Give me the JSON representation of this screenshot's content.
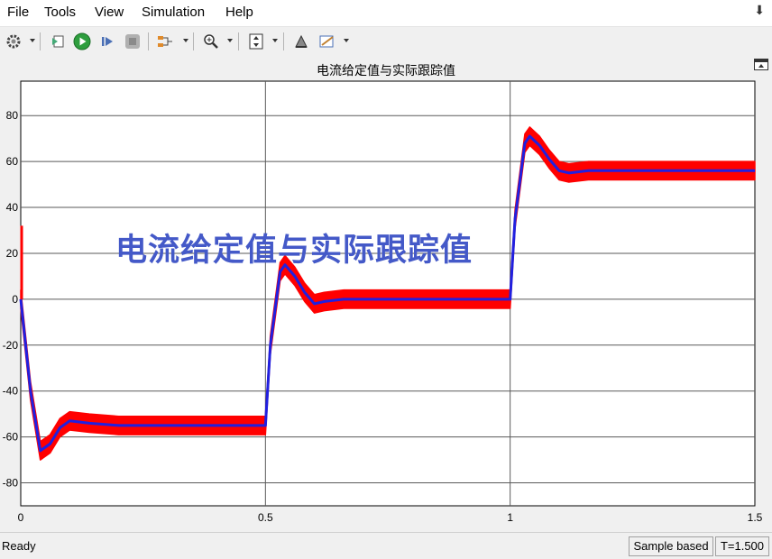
{
  "menu": {
    "items": [
      "File",
      "Tools",
      "View",
      "Simulation",
      "Help"
    ]
  },
  "toolbar": {
    "icons": [
      "gear-icon",
      "restore-config-icon",
      "run-icon",
      "step-forward-icon",
      "stop-icon",
      "signal-select-icon",
      "zoom-icon",
      "autoscale-icon",
      "highlight-icon",
      "style-icon"
    ]
  },
  "plot": {
    "title": "电流给定值与实际跟踪值",
    "overlay_text": "电流给定值与实际跟踪值"
  },
  "status": {
    "text": "Ready",
    "mode": "Sample based",
    "time": "T=1.500"
  },
  "colors": {
    "actual": "#ff0000",
    "reference": "#2020e0",
    "overlay_text": "#4459c8",
    "background": "#ffffff"
  },
  "chart_data": {
    "type": "line",
    "title": "电流给定值与实际跟踪值",
    "xlabel": "",
    "ylabel": "",
    "xlim": [
      0,
      1.5
    ],
    "ylim": [
      -90,
      95
    ],
    "xticks": [
      "0",
      "0.5",
      "1",
      "1.5"
    ],
    "yticks": [
      "-80",
      "-60",
      "-40",
      "-20",
      "0",
      "20",
      "40",
      "60",
      "80"
    ],
    "grid": true,
    "series": [
      {
        "color": "#ff0000",
        "style": "band",
        "x": [
          0,
          0.02,
          0.04,
          0.06,
          0.08,
          0.1,
          0.14,
          0.2,
          0.3,
          0.4,
          0.5,
          0.51,
          0.53,
          0.54,
          0.56,
          0.58,
          0.6,
          0.62,
          0.66,
          0.7,
          0.8,
          0.9,
          1.0,
          1.01,
          1.03,
          1.04,
          1.06,
          1.08,
          1.1,
          1.12,
          1.16,
          1.2,
          1.3,
          1.4,
          1.5
        ],
        "y": [
          0,
          -40,
          -66,
          -63,
          -56,
          -53,
          -54,
          -55,
          -55,
          -55,
          -55,
          -20,
          12,
          15,
          10,
          3,
          -2,
          -1,
          0,
          0,
          0,
          0,
          0,
          35,
          68,
          71,
          67,
          61,
          56,
          55,
          56,
          56,
          56,
          56,
          56
        ],
        "half_width": 4
      },
      {
        "color": "#2020e0",
        "style": "line",
        "x": [
          0,
          0.02,
          0.04,
          0.06,
          0.08,
          0.1,
          0.14,
          0.2,
          0.3,
          0.4,
          0.5,
          0.51,
          0.53,
          0.54,
          0.56,
          0.58,
          0.6,
          0.62,
          0.66,
          0.7,
          0.8,
          0.9,
          1.0,
          1.01,
          1.03,
          1.04,
          1.06,
          1.08,
          1.1,
          1.12,
          1.16,
          1.2,
          1.3,
          1.4,
          1.5
        ],
        "y": [
          0,
          -40,
          -66,
          -63,
          -56,
          -53,
          -54,
          -55,
          -55,
          -55,
          -55,
          -20,
          12,
          15,
          10,
          3,
          -2,
          -1,
          0,
          0,
          0,
          0,
          0,
          35,
          68,
          71,
          67,
          61,
          56,
          55,
          56,
          56,
          56,
          56,
          56
        ]
      }
    ]
  }
}
